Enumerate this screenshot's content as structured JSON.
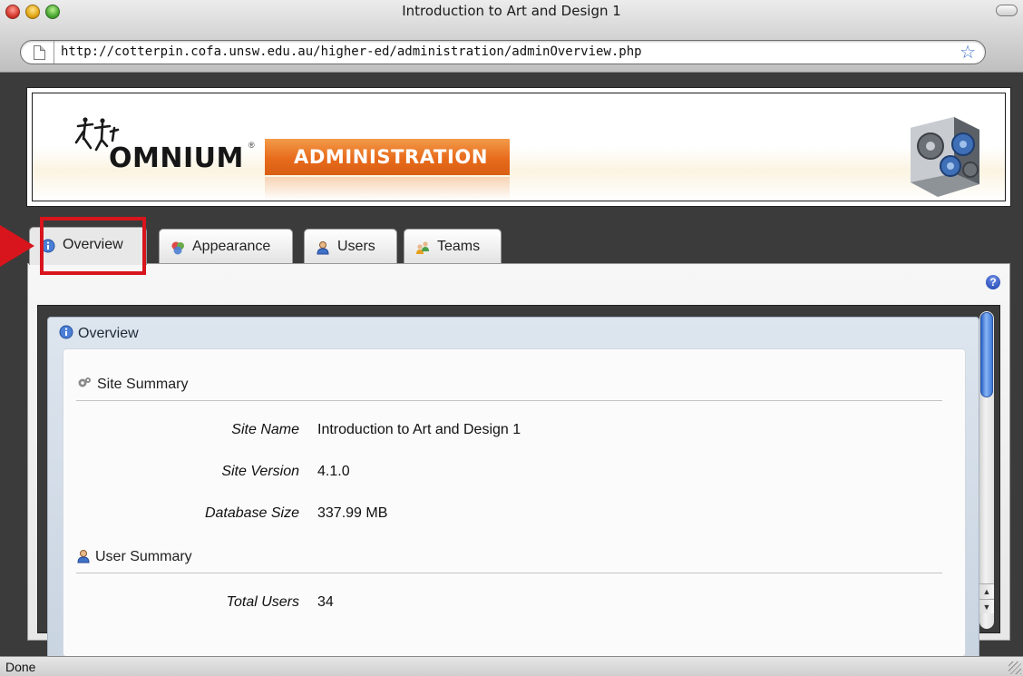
{
  "window": {
    "title": "Introduction to Art and Design 1",
    "url": "http://cotterpin.cofa.unsw.edu.au/higher-ed/administration/adminOverview.php",
    "status": "Done"
  },
  "banner": {
    "logo_text": "OMNIUM",
    "logo_mark": "®",
    "badge_text": "ADMINISTRATION",
    "accent_color": "#e86b1c"
  },
  "tabs": [
    {
      "label": "Overview",
      "icon": "info-icon",
      "active": true
    },
    {
      "label": "Appearance",
      "icon": "appearance-icon",
      "active": false
    },
    {
      "label": "Users",
      "icon": "user-icon",
      "active": false
    },
    {
      "label": "Teams",
      "icon": "teams-icon",
      "active": false
    }
  ],
  "help_icon": "?",
  "overview": {
    "title": "Overview",
    "site_summary": {
      "title": "Site Summary",
      "fields": [
        {
          "label": "Site Name",
          "value": "Introduction to Art and Design 1"
        },
        {
          "label": "Site Version",
          "value": "4.1.0"
        },
        {
          "label": "Database Size",
          "value": "337.99 MB"
        }
      ]
    },
    "user_summary": {
      "title": "User Summary",
      "fields": [
        {
          "label": "Total Users",
          "value": "34"
        }
      ]
    }
  },
  "highlight_color": "#d8141c"
}
